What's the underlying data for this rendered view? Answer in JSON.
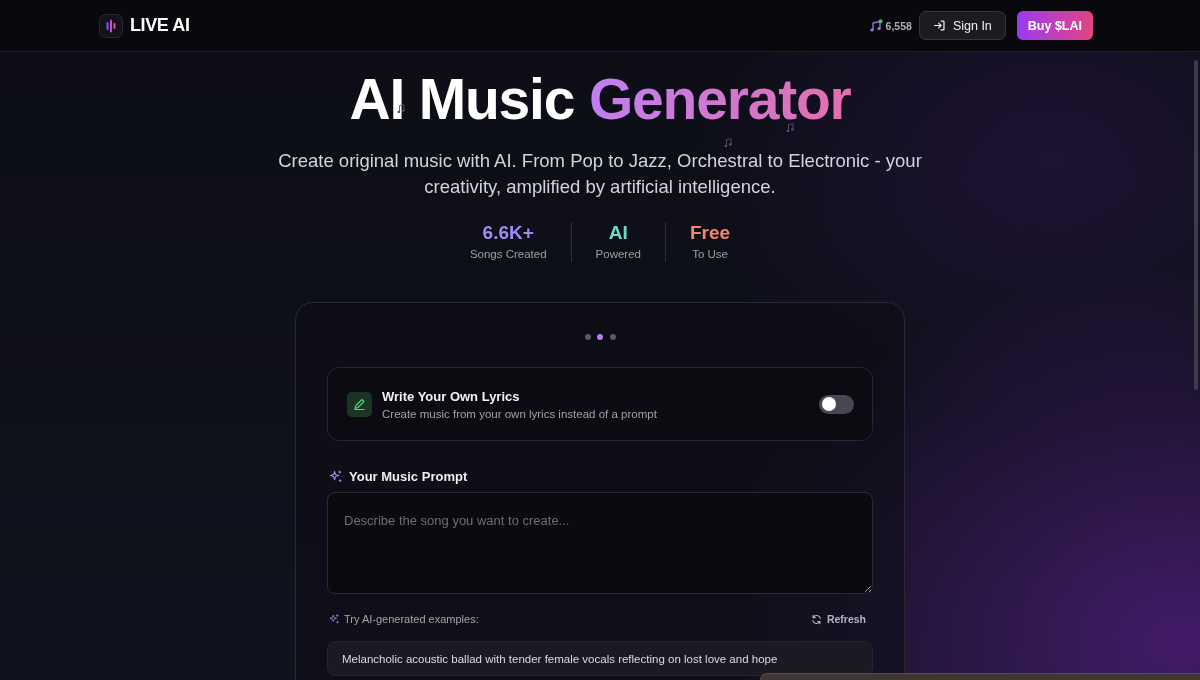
{
  "header": {
    "logo": "LIVE AI",
    "song_count": "6,558",
    "sign_in": "Sign In",
    "buy": "Buy $LAI"
  },
  "hero": {
    "title": "AI Music",
    "title_highlight": "Generator",
    "subtitle": "Create original music with AI. From Pop to Jazz, Orchestral to Electronic - your creativity, amplified by artificial intelligence.",
    "stats": [
      {
        "value": "6.6K+",
        "label": "Songs Created",
        "color": "#9d8cf7"
      },
      {
        "value": "AI",
        "label": "Powered",
        "color": "#6cd9c2"
      },
      {
        "value": "Free",
        "label": "To Use",
        "color": "#f5866e"
      }
    ]
  },
  "generator": {
    "steps": [
      {
        "selected": false
      },
      {
        "selected": true
      },
      {
        "selected": false
      }
    ],
    "lyrics_option": {
      "title": "Write Your Own Lyrics",
      "description": "Create music from your own lyrics instead of a prompt",
      "on": false
    },
    "prompt": {
      "label": "Your Music Prompt",
      "placeholder": "Describe the song you want to create..."
    },
    "examples": {
      "label": "Try AI-generated examples:",
      "refresh": "Refresh",
      "items": [
        "Melancholic acoustic ballad with tender female vocals reflecting on lost love and hope"
      ]
    }
  }
}
